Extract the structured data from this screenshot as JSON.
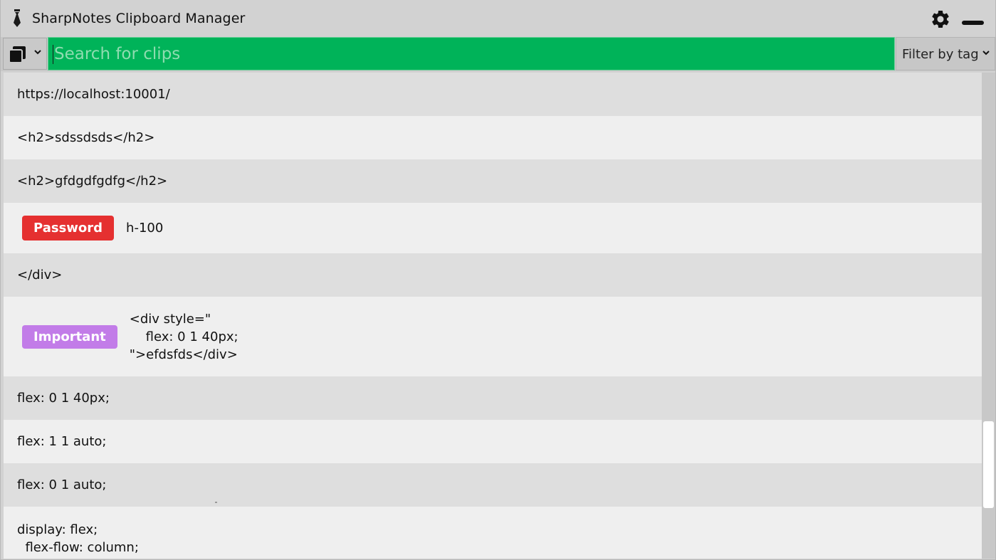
{
  "window": {
    "title": "SharpNotes Clipboard Manager",
    "icons": {
      "app": "tie-icon",
      "settings": "gear-icon",
      "minimize": "minimize-icon"
    }
  },
  "toolbar": {
    "copy_icon": "copy-icon",
    "search_placeholder": "Search for clips",
    "search_value": "",
    "filter_label": "Filter by tag",
    "search_color": "#00b359"
  },
  "clips": [
    {
      "text": "https://localhost:10001/",
      "tag": null
    },
    {
      "text": "<h2>sdssdsds</h2>",
      "tag": null
    },
    {
      "text": "<h2>gfdgdfgdfg</h2>",
      "tag": null
    },
    {
      "text": "h-100",
      "tag": {
        "label": "Password",
        "color": "#e53030"
      }
    },
    {
      "text": "</div>",
      "tag": null
    },
    {
      "text": "<div style=\"\n    flex: 0 1 40px;\n\">efdsfds</div>",
      "tag": {
        "label": "Important",
        "color": "#c27ce8"
      }
    },
    {
      "text": "flex: 0 1 40px;",
      "tag": null
    },
    {
      "text": "flex: 1 1 auto;",
      "tag": null
    },
    {
      "text": "flex: 0 1 auto;",
      "tag": null
    },
    {
      "text": "display: flex;\n  flex-flow: column;",
      "tag": null
    }
  ]
}
